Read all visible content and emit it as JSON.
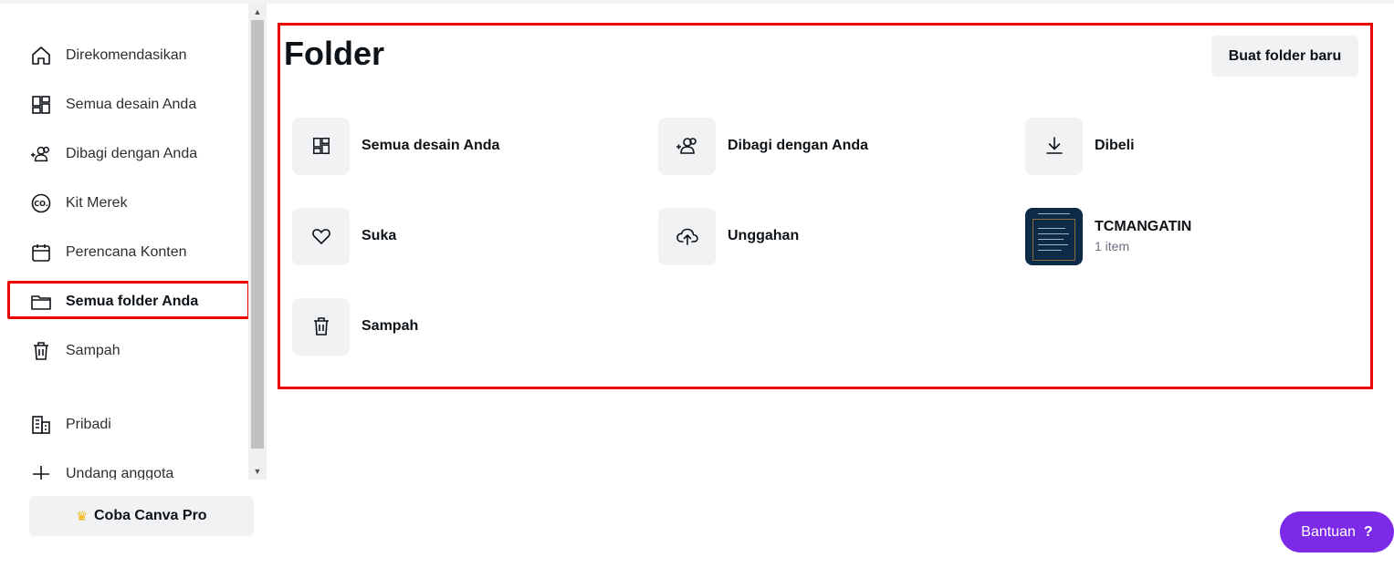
{
  "sidebar": {
    "items": [
      {
        "label": "Direkomendasikan",
        "icon": "home-icon"
      },
      {
        "label": "Semua desain Anda",
        "icon": "grid-icon"
      },
      {
        "label": "Dibagi dengan Anda",
        "icon": "shared-users-icon"
      },
      {
        "label": "Kit Merek",
        "icon": "brand-kit-icon"
      },
      {
        "label": "Perencana Konten",
        "icon": "calendar-icon"
      },
      {
        "label": "Semua folder Anda",
        "icon": "folder-icon",
        "active": true
      },
      {
        "label": "Sampah",
        "icon": "trash-icon"
      },
      {
        "label": "Pribadi",
        "icon": "building-icon"
      },
      {
        "label": "Undang anggota",
        "icon": "plus-icon"
      }
    ],
    "pro_button": "Coba Canva Pro"
  },
  "main": {
    "title": "Folder",
    "new_folder_button": "Buat folder baru",
    "folders": [
      {
        "name": "Semua desain Anda",
        "icon": "grid-icon"
      },
      {
        "name": "Dibagi dengan Anda",
        "icon": "shared-users-icon"
      },
      {
        "name": "Dibeli",
        "icon": "download-icon"
      },
      {
        "name": "Suka",
        "icon": "heart-icon"
      },
      {
        "name": "Unggahan",
        "icon": "cloud-upload-icon"
      },
      {
        "name": "TCMANGATIN",
        "count": "1 item",
        "icon": "folder-thumbnail"
      },
      {
        "name": "Sampah",
        "icon": "trash-icon"
      }
    ]
  },
  "help": {
    "label": "Bantuan",
    "icon_text": "?"
  },
  "colors": {
    "accent": "#7d2ae8",
    "highlight": "#e00000",
    "tile_bg": "#f1f2f4"
  }
}
